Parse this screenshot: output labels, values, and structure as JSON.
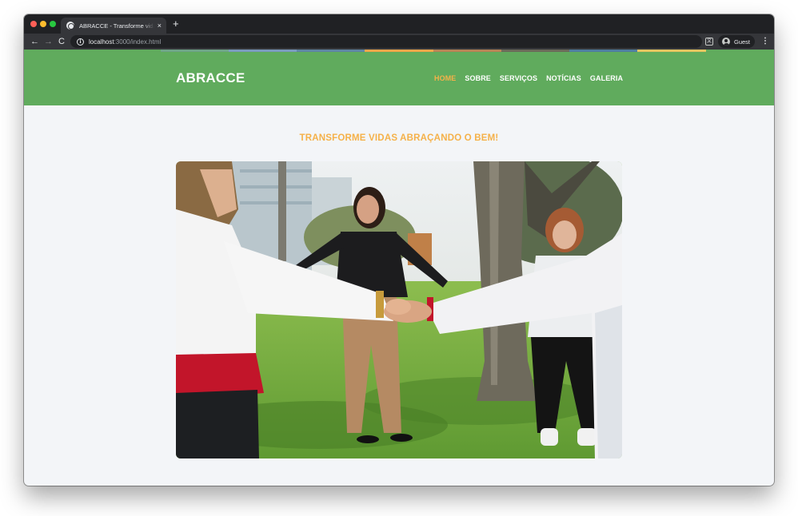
{
  "browser": {
    "tab_title": "ABRACCE - Transforme vidas abraçando o bem",
    "tab_close": "×",
    "new_tab": "+",
    "back": "←",
    "forward": "→",
    "reload": "C",
    "url_host": "localhost",
    "url_rest": ":3000/index.html",
    "profile_label": "Guest",
    "menu": "⋮"
  },
  "header": {
    "brand": "ABRACCE",
    "nav": [
      {
        "label": "HOME",
        "active": true
      },
      {
        "label": "SOBRE",
        "active": false
      },
      {
        "label": "SERVIÇOS",
        "active": false
      },
      {
        "label": "NOTÍCIAS",
        "active": false
      },
      {
        "label": "GALERIA",
        "active": false
      }
    ],
    "strip_colors": [
      "#60ab5d",
      "#60ab5d",
      "#6fa487",
      "#7b9bbf",
      "#5f86a3",
      "#f0a64a",
      "#b88456",
      "#6b6b5a",
      "#4f7ea0",
      "#e5c560",
      "#60ab5d"
    ]
  },
  "main": {
    "headline": "TRANSFORME VIDAS ABRAÇANDO O BEM!"
  },
  "colors": {
    "header_green": "#60ab5d",
    "accent_orange": "#f5b149",
    "page_bg": "#f3f5f8"
  },
  "icons": {
    "favicon": "globe-icon",
    "info": "info-icon",
    "translate": "translate-icon",
    "profile": "person-icon"
  }
}
